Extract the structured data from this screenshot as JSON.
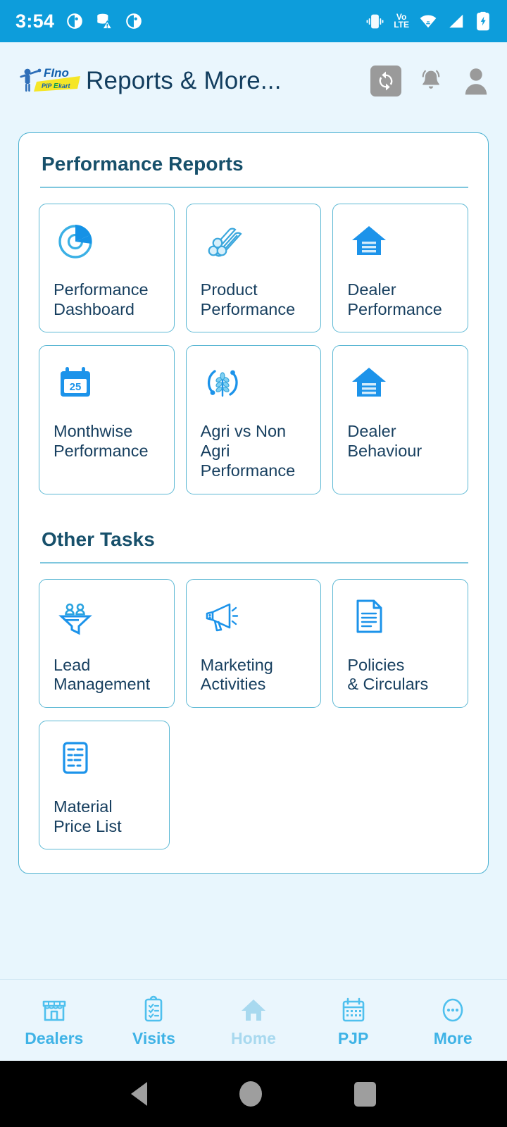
{
  "statusbar": {
    "time": "3:54",
    "left_icons": [
      "notification-dot-icon",
      "database-alert-icon",
      "notification-dot-icon"
    ],
    "volte_top": "Vo",
    "volte_bottom": "LTE",
    "right_icons": [
      "vibrate-icon",
      "volte-icon",
      "wifi-icon",
      "cellular-signal-icon",
      "battery-charging-icon"
    ]
  },
  "appbar": {
    "logo_brand": "Fino",
    "logo_sub": "PIPEkart",
    "title": "Reports & More...",
    "actions": [
      {
        "name": "sync-button",
        "icon": "sync-icon"
      },
      {
        "name": "notifications-button",
        "icon": "bell-icon"
      },
      {
        "name": "profile-button",
        "icon": "person-icon"
      }
    ]
  },
  "sections": [
    {
      "title": "Performance Reports",
      "rows": [
        [
          {
            "label": "Performance\nDashboard",
            "icon": "donut-chart-icon",
            "name": "performance-dashboard"
          },
          {
            "label": "Product\nPerformance",
            "icon": "pipes-icon",
            "name": "product-performance"
          },
          {
            "label": "Dealer\nPerformance",
            "icon": "warehouse-icon",
            "name": "dealer-performance"
          }
        ],
        [
          {
            "label": "Monthwise\nPerformance",
            "icon": "calendar-25-icon",
            "name": "monthwise-performance",
            "calendar_day": "25"
          },
          {
            "label": "Agri vs Non Agri\nPerformance",
            "icon": "wheat-cycle-icon",
            "name": "agri-vs-non-agri-performance"
          },
          {
            "label": "Dealer\nBehaviour",
            "icon": "warehouse-icon",
            "name": "dealer-behaviour"
          }
        ]
      ]
    },
    {
      "title": "Other Tasks",
      "rows": [
        [
          {
            "label": "Lead\nManagement",
            "icon": "lead-funnel-icon",
            "name": "lead-management"
          },
          {
            "label": "Marketing\nActivities",
            "icon": "megaphone-icon",
            "name": "marketing-activities"
          },
          {
            "label": "Policies\n& Circulars",
            "icon": "document-icon",
            "name": "policies-and-circulars"
          }
        ],
        [
          {
            "label": "Material\nPrice List",
            "icon": "price-list-icon",
            "name": "material-price-list"
          }
        ]
      ]
    }
  ],
  "bottomnav": {
    "items": [
      {
        "label": "Dealers",
        "icon": "store-icon",
        "active": true
      },
      {
        "label": "Visits",
        "icon": "clipboard-check-icon",
        "active": true
      },
      {
        "label": "Home",
        "icon": "home-icon",
        "active": false
      },
      {
        "label": "PJP",
        "icon": "calendar-icon",
        "active": true
      },
      {
        "label": "More",
        "icon": "more-dots-icon",
        "active": true
      }
    ]
  },
  "systembar": {
    "buttons": [
      "back-button",
      "home-button",
      "recents-button"
    ]
  },
  "colors": {
    "status_bar": "#0d9ddb",
    "accent_blue": "#2196f3",
    "light_blue": "#5cc4ec",
    "page_bg": "#e8f6fd",
    "heading": "#17506b",
    "tile_border": "#5cb8d4"
  }
}
